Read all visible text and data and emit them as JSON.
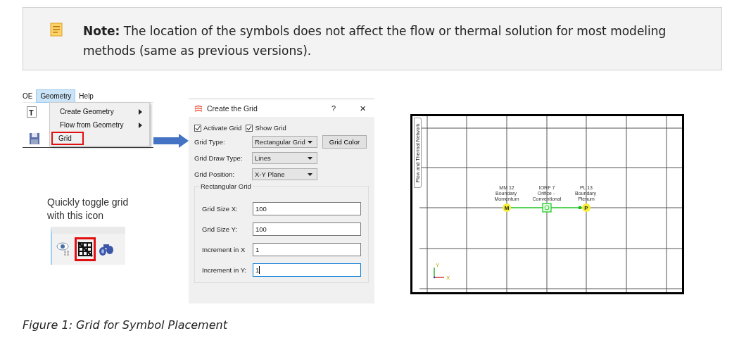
{
  "note": {
    "label": "Note:",
    "text": "The location of the symbols does not affect the flow or thermal solution for most modeling methods (same as previous versions)."
  },
  "menu_screenshot": {
    "menubar": [
      {
        "label": "OE",
        "selected": false
      },
      {
        "label": "Geometry",
        "selected": true
      },
      {
        "label": "Help",
        "selected": false
      }
    ],
    "toolbar_text": "T",
    "menu_items": [
      {
        "label": "Create Geometry",
        "submenu": true,
        "highlighted": false
      },
      {
        "label": "Flow from Geometry",
        "submenu": true,
        "highlighted": false
      },
      {
        "label": "Grid",
        "submenu": false,
        "highlighted": true
      }
    ]
  },
  "toggle_hint": "Quickly toggle grid with this icon",
  "dialog": {
    "title": "Create the Grid",
    "help": "?",
    "close": "×",
    "checkboxes": [
      {
        "label": "Activate Grid",
        "checked": true
      },
      {
        "label": "Show Grid",
        "checked": true
      }
    ],
    "dropdowns": [
      {
        "label": "Grid Type:",
        "value": "Rectangular Grid",
        "button": "Grid Color"
      },
      {
        "label": "Grid Draw Type:",
        "value": "Lines"
      },
      {
        "label": "Grid Position:",
        "value": "X-Y Plane"
      }
    ],
    "group": {
      "title": "Rectangular Grid",
      "fields": [
        {
          "label": "Grid Size X:",
          "value": "100",
          "focused": false
        },
        {
          "label": "Grid Size Y:",
          "value": "100",
          "focused": false
        },
        {
          "label": "Increment in X",
          "value": "1",
          "focused": false
        },
        {
          "label": "Increment in Y:",
          "value": "1",
          "focused": true
        }
      ]
    }
  },
  "network_view": {
    "side_tab": "Flow and Thermal Network",
    "nodes": [
      {
        "kind": "circle",
        "id_label": "MM 12",
        "type_label": "Boundary Momentum",
        "symbol": "M"
      },
      {
        "kind": "square",
        "id_label": "IORF 7",
        "type_label": "Orifice - Conventional"
      },
      {
        "kind": "circle",
        "id_label": "PL 13",
        "type_label": "Boundary Plenum",
        "symbol": "P"
      }
    ],
    "axis_labels": [
      "Y",
      "X"
    ]
  },
  "caption": "Figure 1: Grid for Symbol Placement"
}
